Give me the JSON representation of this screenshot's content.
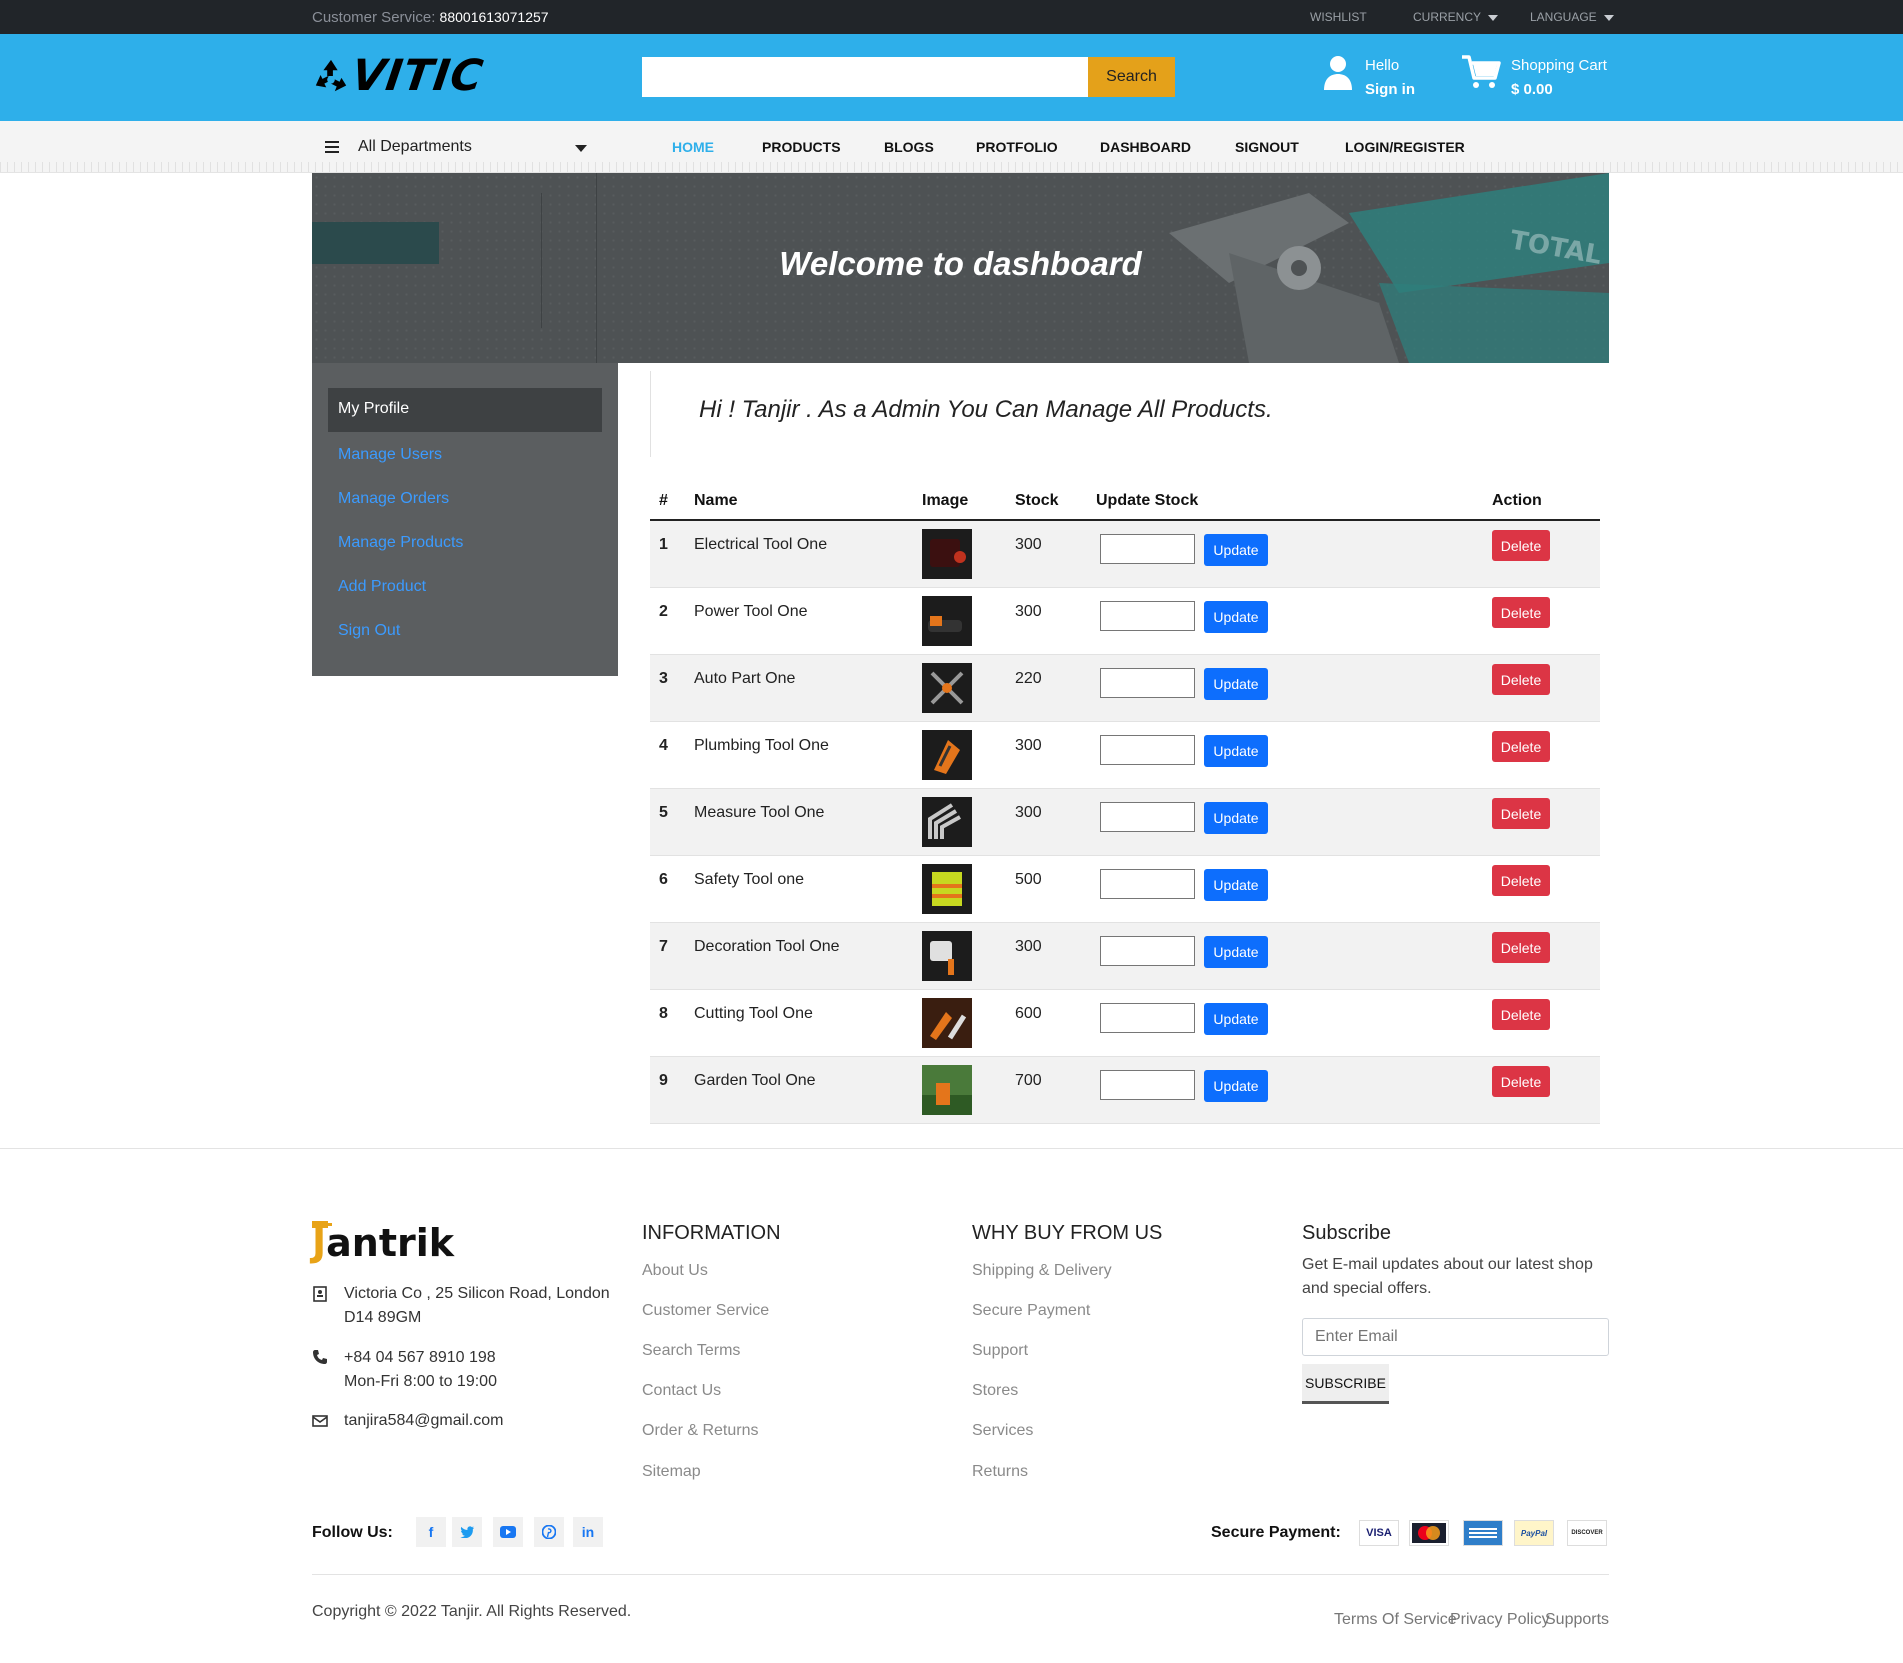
{
  "topbar": {
    "customer_service_label": "Customer Service:",
    "customer_service_number": "88001613071257",
    "wishlist": "WISHLIST",
    "currency": "CURRENCY",
    "language": "LANGUAGE"
  },
  "header": {
    "logo_text": "VITIC",
    "search_placeholder": "",
    "search_button": "Search",
    "user_greeting": "Hello",
    "user_signin": "Sign in",
    "cart_label": "Shopping Cart",
    "cart_total": "$ 0.00"
  },
  "nav": {
    "departments": "All Departments",
    "links": [
      "HOME",
      "PRODUCTS",
      "BLOGS",
      "PROTFOLIO",
      "DASHBOARD",
      "SIGNOUT",
      "LOGIN/REGISTER"
    ],
    "active": "HOME"
  },
  "hero": {
    "title": "Welcome to dashboard"
  },
  "sidebar": {
    "items": [
      "My Profile",
      "Manage Users",
      "Manage Orders",
      "Manage Products",
      "Add Product",
      "Sign Out"
    ]
  },
  "main": {
    "greeting": "Hi ! Tanjir . As a Admin You Can Manage All Products."
  },
  "table": {
    "headers": [
      "#",
      "Name",
      "Image",
      "Stock",
      "Update Stock",
      "Action"
    ],
    "update_label": "Update",
    "delete_label": "Delete",
    "rows": [
      {
        "num": "1",
        "name": "Electrical Tool One",
        "stock": "300"
      },
      {
        "num": "2",
        "name": "Power Tool One",
        "stock": "300"
      },
      {
        "num": "3",
        "name": "Auto Part One",
        "stock": "220"
      },
      {
        "num": "4",
        "name": "Plumbing Tool One",
        "stock": "300"
      },
      {
        "num": "5",
        "name": "Measure Tool One",
        "stock": "300"
      },
      {
        "num": "6",
        "name": "Safety Tool one",
        "stock": "500"
      },
      {
        "num": "7",
        "name": "Decoration Tool One",
        "stock": "300"
      },
      {
        "num": "8",
        "name": "Cutting Tool One",
        "stock": "600"
      },
      {
        "num": "9",
        "name": "Garden Tool One",
        "stock": "700"
      }
    ]
  },
  "footer": {
    "logo_j": "J",
    "logo_rest": "antrik",
    "address_line1": "Victoria Co , 25 Silicon Road, London",
    "address_line2": "D14 89GM",
    "phone": "+84 04 567 8910 198",
    "hours": "Mon-Fri 8:00 to 19:00",
    "email": "tanjira584@gmail.com",
    "info_heading": "INFORMATION",
    "info_links": [
      "About Us",
      "Customer Service",
      "Search Terms",
      "Contact Us",
      "Order & Returns",
      "Sitemap"
    ],
    "why_heading": "WHY BUY FROM US",
    "why_links": [
      "Shipping & Delivery",
      "Secure Payment",
      "Support",
      "Stores",
      "Services",
      "Returns"
    ],
    "subscribe_heading": "Subscribe",
    "subscribe_text": "Get E-mail updates about our latest shop and special offers.",
    "subscribe_placeholder": "Enter Email",
    "subscribe_button": "SUBSCRIBE",
    "follow_label": "Follow Us:",
    "social_icons": [
      "facebook-icon",
      "twitter-icon",
      "youtube-icon",
      "pinterest-icon",
      "linkedin-icon"
    ],
    "secure_label": "Secure Payment:",
    "cards": [
      "VISA",
      "MasterCard",
      "AMEX",
      "PayPal",
      "DISCOVER"
    ],
    "copyright": "Copyright © 2022 Tanjir. All Rights Reserved.",
    "legal_links": [
      "Terms Of Service",
      "Privacy Policy",
      "Supports"
    ]
  },
  "colors": {
    "header_bg": "#2eafea",
    "topbar_bg": "#212529",
    "search_button": "#e4a11a",
    "update_button": "#0d6efd",
    "delete_button": "#dc3545",
    "sidebar_bg": "#5b5e60",
    "sidebar_link": "#3b9bff"
  }
}
